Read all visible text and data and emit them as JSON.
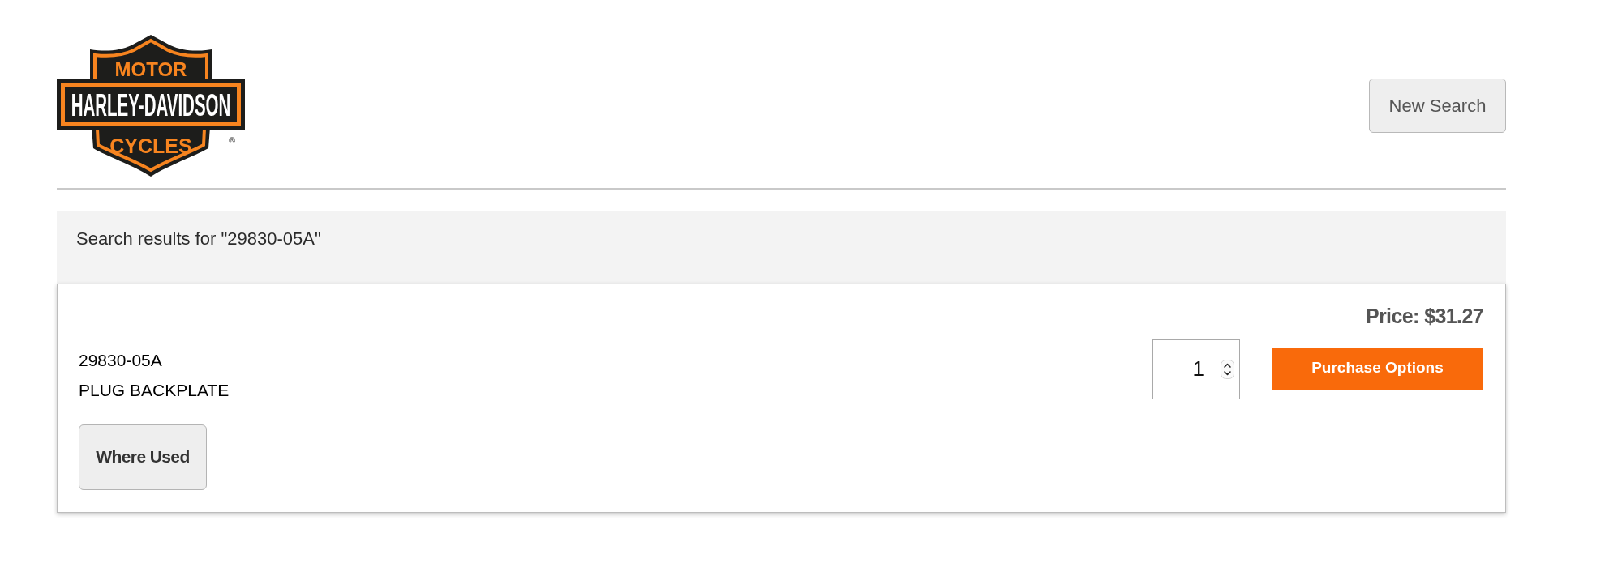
{
  "header": {
    "logo": {
      "top_text": "MOTOR",
      "wordmark": "HARLEY-DAVIDSON",
      "bottom_text": "CYCLES",
      "registered_mark": "®"
    },
    "new_search_button": "New Search"
  },
  "results": {
    "heading": "Search results for \"29830-05A\"",
    "items": [
      {
        "part_number": "29830-05A",
        "description": "PLUG BACKPLATE",
        "where_used_button": "Where Used",
        "price": "Price: $31.27",
        "quantity": "1",
        "purchase_button": "Purchase Options"
      }
    ]
  }
}
